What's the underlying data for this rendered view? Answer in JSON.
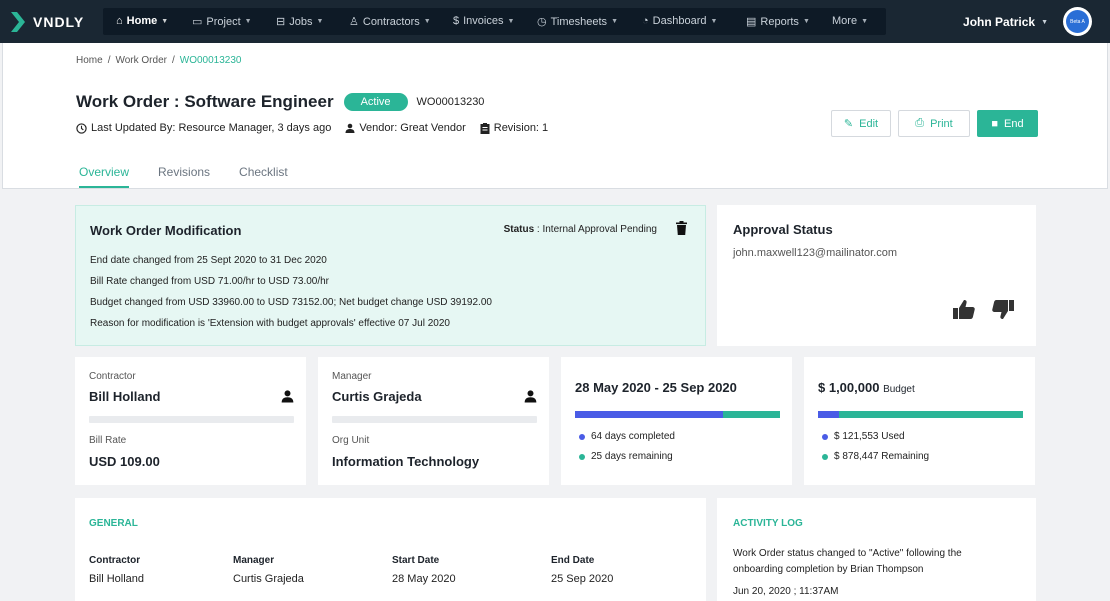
{
  "nav": {
    "brand": "VNDLY",
    "items": [
      {
        "label": "Home",
        "icon": "home-icon"
      },
      {
        "label": "Project",
        "icon": "project-icon"
      },
      {
        "label": "Jobs",
        "icon": "jobs-icon"
      },
      {
        "label": "Contractors",
        "icon": "contractors-icon"
      },
      {
        "label": "Invoices",
        "icon": "dollar-icon"
      },
      {
        "label": "Timesheets",
        "icon": "clock-icon"
      },
      {
        "label": "Dashboard",
        "icon": "gauge-icon"
      },
      {
        "label": "Reports",
        "icon": "report-icon"
      },
      {
        "label": "More",
        "icon": ""
      }
    ],
    "user": "John Patrick",
    "avatar_text": "Beta A"
  },
  "breadcrumb": {
    "home": "Home",
    "sep": "/",
    "work_order": "Work Order",
    "current": "WO00013230"
  },
  "header": {
    "title": "Work Order : Software Engineer",
    "status": "Active",
    "id": "WO00013230",
    "updated": "Last Updated By: Resource Manager, 3 days ago",
    "vendor": "Vendor: Great Vendor",
    "revision": "Revision: 1",
    "edit": "Edit",
    "print": "Print",
    "end": "End"
  },
  "tabs": [
    "Overview",
    "Revisions",
    "Checklist"
  ],
  "modification": {
    "title": "Work Order Modification",
    "status_label": "Status",
    "status_value": ": Internal Approval Pending",
    "lines": [
      "End date changed from 25 Sept 2020 to 31 Dec 2020",
      "Bill Rate changed from USD 71.00/hr to USD 73.00/hr",
      "Budget changed from USD 33960.00 to USD 73152.00; Net budget change USD 39192.00",
      "Reason for modification is 'Extension with budget approvals' effective 07 Jul 2020"
    ]
  },
  "approval": {
    "title": "Approval Status",
    "email": "john.maxwell123@mailinator.com"
  },
  "contractor_card": {
    "label": "Contractor",
    "name": "Bill Holland",
    "rate_label": "Bill Rate",
    "rate": "USD 109.00"
  },
  "manager_card": {
    "label": "Manager",
    "name": "Curtis Grajeda",
    "org_label": "Org Unit",
    "org": "Information Technology"
  },
  "dates_card": {
    "title": "28 May 2020 - 25 Sep 2020",
    "completed": "64 days completed",
    "remaining": "25 days remaining",
    "progress": 0.72
  },
  "budget_card": {
    "amount": "$ 1,00,000",
    "suffix": "Budget",
    "used": "$ 121,553 Used",
    "remaining_text": "$ 878,447 Remaining",
    "progress": 0.1
  },
  "general": {
    "title": "GENERAL",
    "cols": [
      {
        "h": "Contractor",
        "v": "Bill Holland"
      },
      {
        "h": "Manager",
        "v": "Curtis Grajeda"
      },
      {
        "h": "Start Date",
        "v": "28 May 2020"
      },
      {
        "h": "End Date",
        "v": "25 Sep 2020"
      }
    ]
  },
  "activity": {
    "title": "ACTIVITY LOG",
    "text": "Work Order status changed to \"Active\" following the onboarding completion by Brian Thompson",
    "time": "Jun 20, 2020 ; 11:37AM"
  },
  "colors": {
    "accent": "#2bb597",
    "nav": "#1a2733",
    "progress": "#4a5ce6"
  }
}
